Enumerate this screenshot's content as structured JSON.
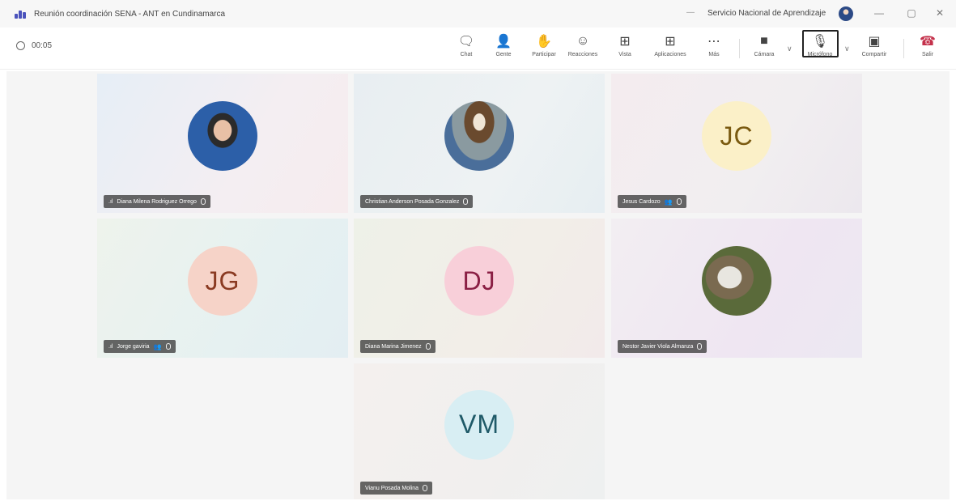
{
  "window": {
    "title": "Reunión coordinación SENA - ANT en Cundinamarca",
    "org": "Servicio Nacional de Aprendizaje",
    "controls": [
      "—",
      "▢",
      "✕"
    ]
  },
  "toolbar": {
    "timer": "00:05",
    "buttons": {
      "chat": "Chat",
      "people": "Gente",
      "raise": "Participar",
      "reactions": "Reacciones",
      "view": "Vista",
      "apps": "Aplicaciones",
      "more": "Más",
      "camera": "Cámara",
      "mic": "Micrófono",
      "share": "Compartir",
      "leave": "Salir"
    },
    "icons": {
      "chat": "chat-icon",
      "people": "people-icon",
      "raise": "hand-icon",
      "reactions": "smile-icon",
      "view": "grid-icon",
      "apps": "plus-box-icon",
      "more": "more-icon",
      "camera": "camera-off-icon",
      "mic": "mic-off-icon",
      "share": "share-icon",
      "leave": "hangup-icon"
    },
    "leave_color": "#c4314b"
  },
  "participants": [
    {
      "name": "Diana Milena Rodriguez Orrego",
      "initials": "",
      "photo": true,
      "signal": true,
      "group": false
    },
    {
      "name": "Christian Anderson Posada Gonzalez",
      "initials": "",
      "photo": true,
      "signal": false,
      "group": false
    },
    {
      "name": "Jesus Cardozo",
      "initials": "JC",
      "photo": false,
      "signal": false,
      "group": true,
      "avatar_bg": "#fbf0c8",
      "avatar_fg": "#7a5a10"
    },
    {
      "name": "Jorge gaviria",
      "initials": "JG",
      "photo": false,
      "signal": true,
      "group": true,
      "avatar_bg": "#f6d3c8",
      "avatar_fg": "#8a3a22"
    },
    {
      "name": "Diana Marina Jimenez",
      "initials": "DJ",
      "photo": false,
      "signal": false,
      "group": false,
      "avatar_bg": "#f8cfd9",
      "avatar_fg": "#8a1f44"
    },
    {
      "name": "Nestor Javier Viola Almanza",
      "initials": "",
      "photo": true,
      "signal": false,
      "group": false
    },
    {
      "name": "Vianu Posada Molina",
      "initials": "VM",
      "photo": false,
      "signal": false,
      "group": false,
      "avatar_bg": "#d8eef3",
      "avatar_fg": "#1f5a68"
    }
  ]
}
